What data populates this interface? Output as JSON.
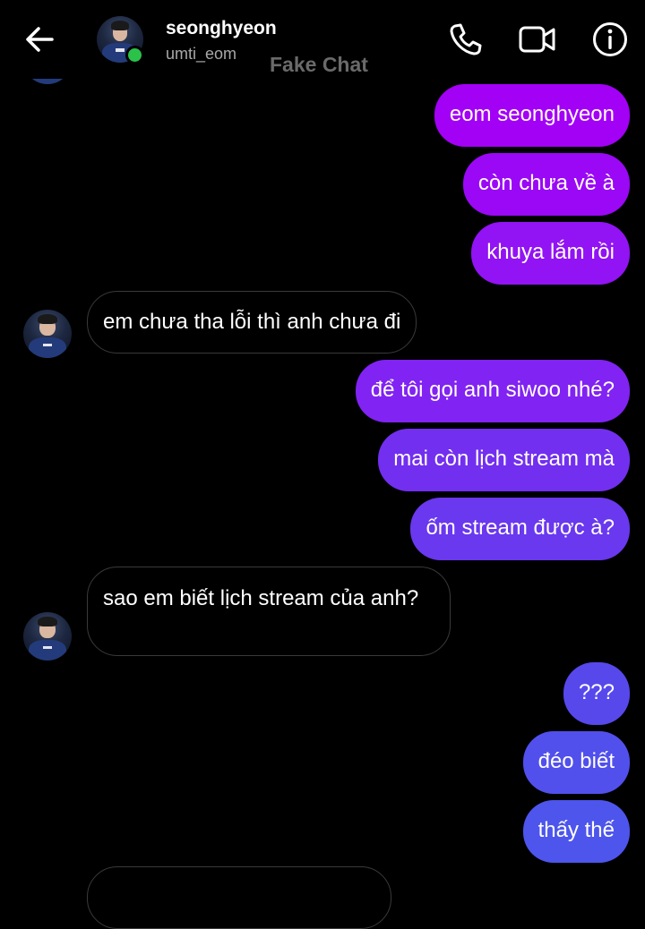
{
  "header": {
    "contact_name": "seonghyeon",
    "contact_handle": "umti_eom",
    "watermark": "Fake Chat",
    "icons": [
      "back-arrow-icon",
      "phone-icon",
      "video-camera-icon",
      "info-icon"
    ],
    "online_color": "#2bc24a"
  },
  "messages": [
    {
      "from": "me",
      "text": "eom seonghyeon"
    },
    {
      "from": "me",
      "text": "còn chưa về à"
    },
    {
      "from": "me",
      "text": "khuya lắm rồi"
    },
    {
      "from": "them",
      "text": "em chưa tha lỗi thì anh chưa đi"
    },
    {
      "from": "me",
      "text": "để tôi gọi anh siwoo nhé?"
    },
    {
      "from": "me",
      "text": "mai còn lịch stream mà"
    },
    {
      "from": "me",
      "text": "ốm stream được à?"
    },
    {
      "from": "them",
      "text": "sao em biết lịch stream của anh?"
    },
    {
      "from": "me",
      "text": "???"
    },
    {
      "from": "me",
      "text": "đéo biết"
    },
    {
      "from": "me",
      "text": "thấy thế"
    }
  ],
  "colors": {
    "background": "#000000",
    "outgoing_gradient_top": "#a400f6",
    "outgoing_gradient_bottom": "#4d55ec",
    "incoming_border": "#3a3a3a"
  }
}
